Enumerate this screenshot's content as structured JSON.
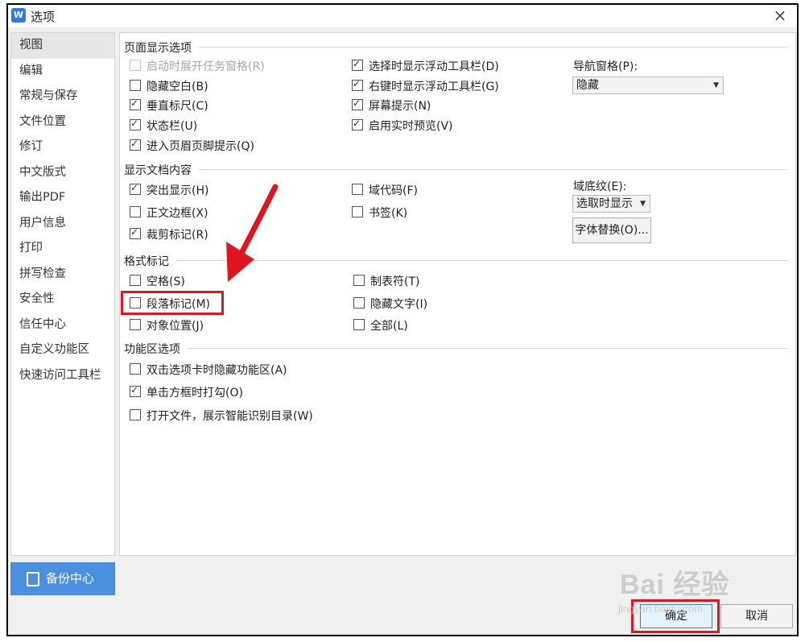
{
  "window": {
    "title": "选项",
    "app_icon_text": "W",
    "close_symbol": "×"
  },
  "sidebar": {
    "items": [
      {
        "label": "视图",
        "active": true
      },
      {
        "label": "编辑"
      },
      {
        "label": "常规与保存"
      },
      {
        "label": "文件位置"
      },
      {
        "label": "修订"
      },
      {
        "label": "中文版式"
      },
      {
        "label": "输出PDF"
      },
      {
        "label": "用户信息"
      },
      {
        "label": "打印"
      },
      {
        "label": "拼写检查"
      },
      {
        "label": "安全性"
      },
      {
        "label": "信任中心"
      },
      {
        "label": "自定义功能区"
      },
      {
        "label": "快速访问工具栏"
      }
    ],
    "backup_label": "备份中心"
  },
  "page_display": {
    "title": "页面显示选项",
    "options": [
      {
        "label": "启动时展开任务窗格(R)",
        "checked": false,
        "disabled": true
      },
      {
        "label": "隐藏空白(B)",
        "checked": false
      },
      {
        "label": "垂直标尺(C)",
        "checked": true
      },
      {
        "label": "状态栏(U)",
        "checked": true
      },
      {
        "label": "进入页眉页脚提示(Q)",
        "checked": true
      },
      {
        "label": "选择时显示浮动工具栏(D)",
        "checked": true
      },
      {
        "label": "右键时显示浮动工具栏(G)",
        "checked": true
      },
      {
        "label": "屏幕提示(N)",
        "checked": true
      },
      {
        "label": "启用实时预览(V)",
        "checked": true
      }
    ],
    "nav_label": "导航窗格(P):",
    "nav_value": "隐藏"
  },
  "doc_content": {
    "title": "显示文档内容",
    "options": [
      {
        "label": "突出显示(H)",
        "checked": true
      },
      {
        "label": "正文边框(X)",
        "checked": false
      },
      {
        "label": "裁剪标记(R)",
        "checked": true
      },
      {
        "label": "域代码(F)",
        "checked": false
      },
      {
        "label": "书签(K)",
        "checked": false
      }
    ],
    "shading_label": "域底纹(E):",
    "shading_value": "选取时显示",
    "font_replace_label": "字体替换(O)..."
  },
  "format_marks": {
    "title": "格式标记",
    "options": [
      {
        "label": "空格(S)",
        "checked": false
      },
      {
        "label": "段落标记(M)",
        "checked": false
      },
      {
        "label": "对象位置(J)",
        "checked": false
      },
      {
        "label": "制表符(T)",
        "checked": false
      },
      {
        "label": "隐藏文字(I)",
        "checked": false
      },
      {
        "label": "全部(L)",
        "checked": false
      }
    ]
  },
  "ribbon": {
    "title": "功能区选项",
    "options": [
      {
        "label": "双击选项卡时隐藏功能区(A)",
        "checked": false
      },
      {
        "label": "单击方框时打勾(O)",
        "checked": true
      },
      {
        "label": "打开文件，展示智能识别目录(W)",
        "checked": false
      }
    ]
  },
  "footer": {
    "ok_label": "确定",
    "cancel_label": "取消"
  },
  "annotations": {
    "highlight_color": "#e0161e"
  },
  "watermark": {
    "main": "Bai  经验",
    "sub": "jingyan.baidu.com"
  }
}
